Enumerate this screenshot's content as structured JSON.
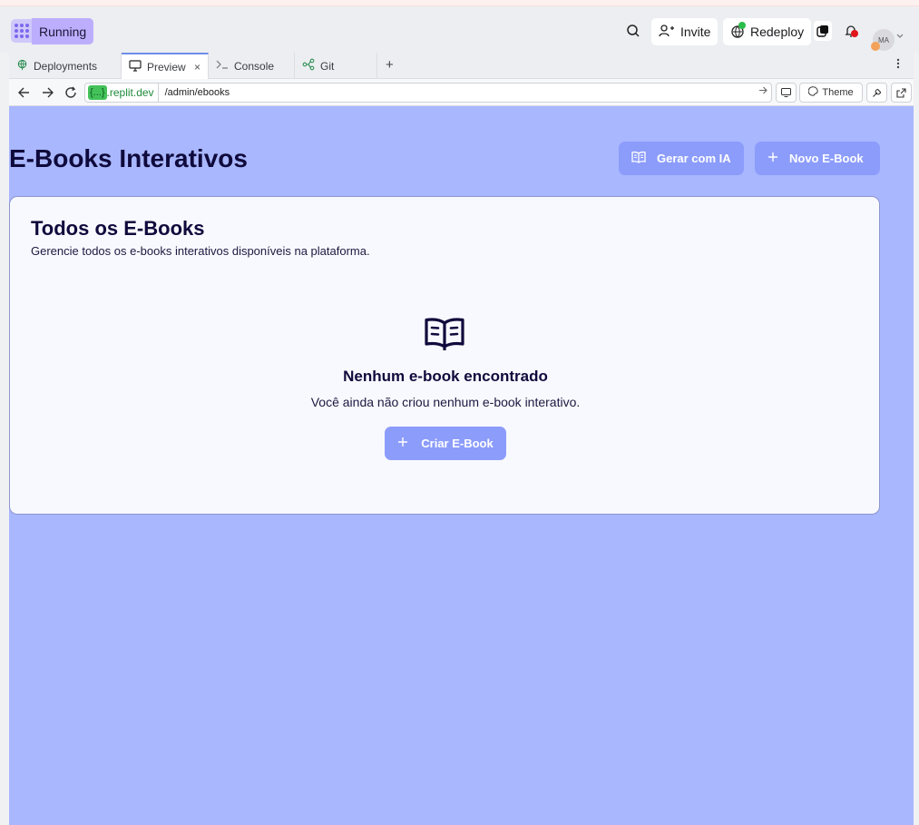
{
  "header": {
    "status_label": "Running",
    "invite_label": "Invite",
    "redeploy_label": "Redeploy",
    "avatar_initials": "MA"
  },
  "tabs": [
    {
      "label": "Deployments",
      "icon": "globe-icon",
      "active": false
    },
    {
      "label": "Preview",
      "icon": "monitor-icon",
      "active": true
    },
    {
      "label": "Console",
      "icon": "terminal-icon",
      "active": false
    },
    {
      "label": "Git",
      "icon": "git-branch-icon",
      "active": false
    }
  ],
  "tab_close_glyph": "×",
  "tab_add_glyph": "+",
  "url": {
    "chip": "{...}",
    "domain": ".replit.dev",
    "path": "/admin/ebooks"
  },
  "theme_label": "Theme",
  "page": {
    "title": "E-Books Interativos",
    "ai_button": "Gerar com IA",
    "new_button": "Novo E-Book",
    "card_title": "Todos os E-Books",
    "card_subtitle": "Gerencie todos os e-books interativos disponíveis na plataforma.",
    "empty_title": "Nenhum e-book encontrado",
    "empty_text": "Você ainda não criou nenhum e-book interativo.",
    "create_button": "Criar E-Book"
  },
  "colors": {
    "preview_bg": "#a9b7fe",
    "button_bg": "#8c9cfb",
    "title_text": "#0f0a3c",
    "status_pill": "#bcaefc"
  }
}
